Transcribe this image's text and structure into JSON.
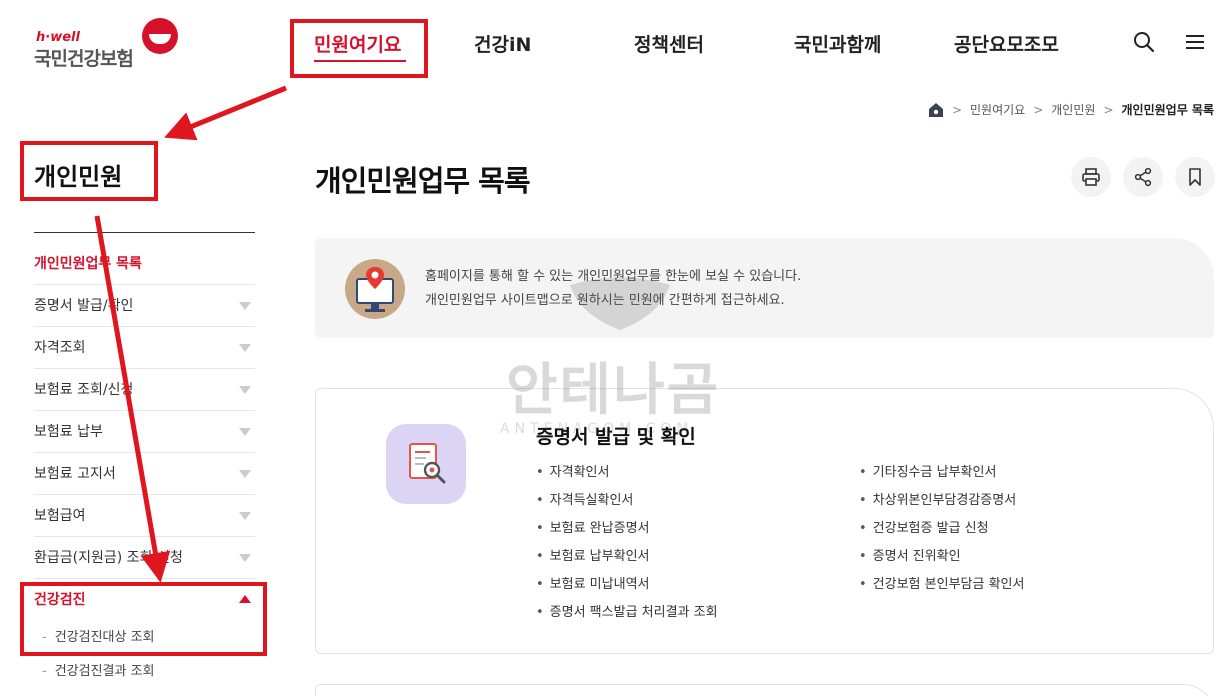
{
  "brand": {
    "small": "h·well",
    "name": "국민건강보험"
  },
  "gnb": [
    {
      "label": "민원여기요",
      "active": true
    },
    {
      "label": "건강iN"
    },
    {
      "label": "정책센터"
    },
    {
      "label": "국민과함께"
    },
    {
      "label": "공단요모조모"
    }
  ],
  "breadcrumb": {
    "items": [
      "민원여기요",
      "개인민원"
    ],
    "current": "개인민원업무 목록"
  },
  "lnb": {
    "title": "개인민원",
    "items": [
      {
        "label": "개인민원업무 목록"
      },
      {
        "label": "증명서 발급/확인"
      },
      {
        "label": "자격조회"
      },
      {
        "label": "보험료 조회/신청"
      },
      {
        "label": "보험료 납부"
      },
      {
        "label": "보험료 고지서"
      },
      {
        "label": "보험급여"
      },
      {
        "label": "환급금(지원금) 조회/신청"
      },
      {
        "label": "건강검진"
      }
    ],
    "subitems": [
      "건강검진대상 조회",
      "건강검진결과 조회"
    ]
  },
  "main": {
    "title": "개인민원업무 목록",
    "intro": [
      "홈페이지를 통해 할 수 있는 개인민원업무를 한눈에 보실 수 있습니다.",
      "개인민원업무 사이트맵으로 원하시는 민원에 간편하게 접근하세요."
    ],
    "card": {
      "title": "증명서 발급 및 확인",
      "left": [
        "자격확인서",
        "자격득실확인서",
        "보험료 완납증명서",
        "보험료 납부확인서",
        "보험료 미납내역서",
        "증명서 팩스발급 처리결과 조회"
      ],
      "right": [
        "기타징수금 납부확인서",
        "차상위본인부담경감증명서",
        "건강보험증 발급 신청",
        "증명서 진위확인",
        "건강보험 본인부담금 확인서"
      ]
    }
  },
  "watermark": {
    "text": "안테나곰",
    "sub": "ANTENAGOM.COM"
  },
  "icons": [
    "search-icon",
    "menu-icon",
    "home-icon",
    "print-icon",
    "share-icon",
    "bookmark-icon"
  ],
  "colors": {
    "brand_red": "#d7112a",
    "callout_red": "#e0161f"
  }
}
